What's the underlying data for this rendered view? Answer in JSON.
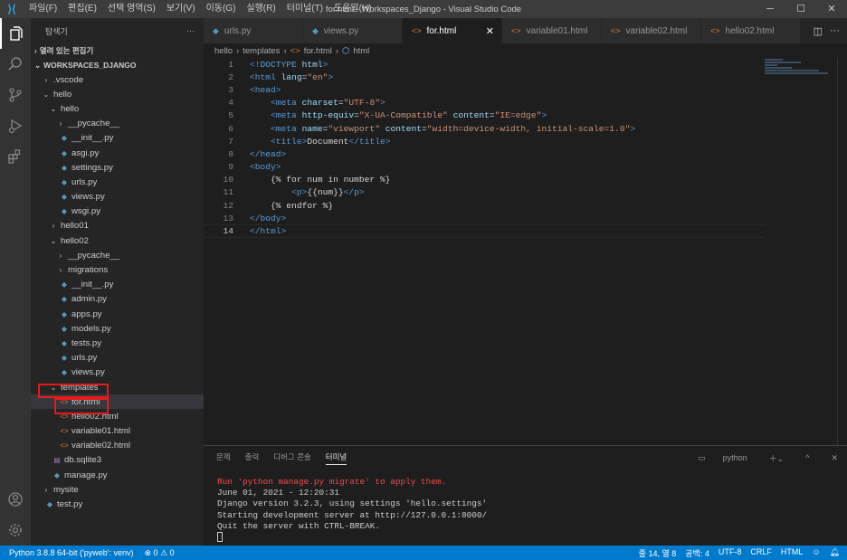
{
  "titlebar": {
    "menu": [
      "파일(F)",
      "편집(E)",
      "선택 영역(S)",
      "보기(V)",
      "이동(G)",
      "실행(R)",
      "터미널(T)",
      "도움말(H)"
    ],
    "window_title": "for.html - Workspaces_Django - Visual Studio Code"
  },
  "sidebar": {
    "header": "탐색기",
    "open_editors": "열려 있는 편집기",
    "workspace": "WORKSPACES_DJANGO",
    "tree": [
      {
        "label": ".vscode",
        "type": "folder",
        "open": false,
        "depth": 1
      },
      {
        "label": "hello",
        "type": "folder",
        "open": true,
        "depth": 1
      },
      {
        "label": "hello",
        "type": "folder",
        "open": true,
        "depth": 2
      },
      {
        "label": "__pycache__",
        "type": "folder",
        "open": false,
        "depth": 3
      },
      {
        "label": "__init__.py",
        "type": "py",
        "depth": 3
      },
      {
        "label": "asgi.py",
        "type": "py",
        "depth": 3
      },
      {
        "label": "settings.py",
        "type": "py",
        "depth": 3
      },
      {
        "label": "urls.py",
        "type": "py",
        "depth": 3
      },
      {
        "label": "views.py",
        "type": "py",
        "depth": 3
      },
      {
        "label": "wsgi.py",
        "type": "py",
        "depth": 3
      },
      {
        "label": "hello01",
        "type": "folder",
        "open": false,
        "depth": 2
      },
      {
        "label": "hello02",
        "type": "folder",
        "open": true,
        "depth": 2
      },
      {
        "label": "__pycache__",
        "type": "folder",
        "open": false,
        "depth": 3
      },
      {
        "label": "migrations",
        "type": "folder",
        "open": false,
        "depth": 3
      },
      {
        "label": "__init__.py",
        "type": "py",
        "depth": 3
      },
      {
        "label": "admin.py",
        "type": "py",
        "depth": 3
      },
      {
        "label": "apps.py",
        "type": "py",
        "depth": 3
      },
      {
        "label": "models.py",
        "type": "py",
        "depth": 3
      },
      {
        "label": "tests.py",
        "type": "py",
        "depth": 3
      },
      {
        "label": "urls.py",
        "type": "py",
        "depth": 3
      },
      {
        "label": "views.py",
        "type": "py",
        "depth": 3
      },
      {
        "label": "templates",
        "type": "folder",
        "open": true,
        "depth": 2
      },
      {
        "label": "for.html",
        "type": "html",
        "depth": 3,
        "selected": true
      },
      {
        "label": "hello02.html",
        "type": "html",
        "depth": 3
      },
      {
        "label": "variable01.html",
        "type": "html",
        "depth": 3
      },
      {
        "label": "variable02.html",
        "type": "html",
        "depth": 3
      },
      {
        "label": "db.sqlite3",
        "type": "db",
        "depth": 2
      },
      {
        "label": "manage.py",
        "type": "py",
        "depth": 2
      },
      {
        "label": "mysite",
        "type": "folder",
        "open": false,
        "depth": 1
      },
      {
        "label": "test.py",
        "type": "py",
        "depth": 1
      }
    ]
  },
  "tabs": [
    {
      "label": "urls.py",
      "type": "py"
    },
    {
      "label": "views.py",
      "type": "py"
    },
    {
      "label": "for.html",
      "type": "html",
      "active": true
    },
    {
      "label": "variable01.html",
      "type": "html"
    },
    {
      "label": "variable02.html",
      "type": "html"
    },
    {
      "label": "hello02.html",
      "type": "html"
    }
  ],
  "breadcrumb": [
    "hello",
    "templates",
    "for.html",
    "html"
  ],
  "editor": {
    "current_line": 14,
    "lines": [
      [
        [
          "t",
          "<!DOCTYPE "
        ],
        [
          "a",
          "html"
        ],
        [
          "t",
          ">"
        ]
      ],
      [
        [
          "t",
          "<html "
        ],
        [
          "a",
          "lang"
        ],
        [
          "d",
          "="
        ],
        [
          "s",
          "\"en\""
        ],
        [
          "t",
          ">"
        ]
      ],
      [
        [
          "t",
          "<head>"
        ]
      ],
      [
        [
          "d",
          "    "
        ],
        [
          "t",
          "<meta "
        ],
        [
          "a",
          "charset"
        ],
        [
          "d",
          "="
        ],
        [
          "s",
          "\"UTF-8\""
        ],
        [
          "t",
          ">"
        ]
      ],
      [
        [
          "d",
          "    "
        ],
        [
          "t",
          "<meta "
        ],
        [
          "a",
          "http-equiv"
        ],
        [
          "d",
          "="
        ],
        [
          "s",
          "\"X-UA-Compatible\""
        ],
        [
          "d",
          " "
        ],
        [
          "a",
          "content"
        ],
        [
          "d",
          "="
        ],
        [
          "s",
          "\"IE=edge\""
        ],
        [
          "t",
          ">"
        ]
      ],
      [
        [
          "d",
          "    "
        ],
        [
          "t",
          "<meta "
        ],
        [
          "a",
          "name"
        ],
        [
          "d",
          "="
        ],
        [
          "s",
          "\"viewport\""
        ],
        [
          "d",
          " "
        ],
        [
          "a",
          "content"
        ],
        [
          "d",
          "="
        ],
        [
          "s",
          "\"width=device-width, initial-scale=1.0\""
        ],
        [
          "t",
          ">"
        ]
      ],
      [
        [
          "d",
          "    "
        ],
        [
          "t",
          "<title>"
        ],
        [
          "d",
          "Document"
        ],
        [
          "t",
          "</title>"
        ]
      ],
      [
        [
          "t",
          "</head>"
        ]
      ],
      [
        [
          "t",
          "<body>"
        ]
      ],
      [
        [
          "d",
          "    {% for num in number %}"
        ]
      ],
      [
        [
          "d",
          "        "
        ],
        [
          "t",
          "<p>"
        ],
        [
          "d",
          "{{num}}"
        ],
        [
          "t",
          "</p>"
        ]
      ],
      [
        [
          "d",
          "    {% endfor %}"
        ]
      ],
      [
        [
          "t",
          "</body>"
        ]
      ],
      [
        [
          "t",
          "</html>"
        ]
      ]
    ]
  },
  "panel": {
    "tabs": [
      "문제",
      "출력",
      "디버그 콘솔",
      "터미널"
    ],
    "active_tab": "터미널",
    "terminal_name": "python",
    "terminal": [
      {
        "text": "Run 'python manage.py migrate' to apply them.",
        "warn": true
      },
      {
        "text": "June 01, 2021 - 12:20:31"
      },
      {
        "text": "Django version 3.2.3, using settings 'hello.settings'"
      },
      {
        "text": "Starting development server at http://127.0.0.1:8000/"
      },
      {
        "text": "Quit the server with CTRL-BREAK."
      }
    ]
  },
  "statusbar": {
    "python": "Python 3.8.8 64-bit ('pyweb': venv)",
    "problems": "⊗ 0 ⚠ 0",
    "position": "줄 14, 열 8",
    "spaces": "공백: 4",
    "encoding": "UTF-8",
    "eol": "CRLF",
    "language": "HTML"
  }
}
